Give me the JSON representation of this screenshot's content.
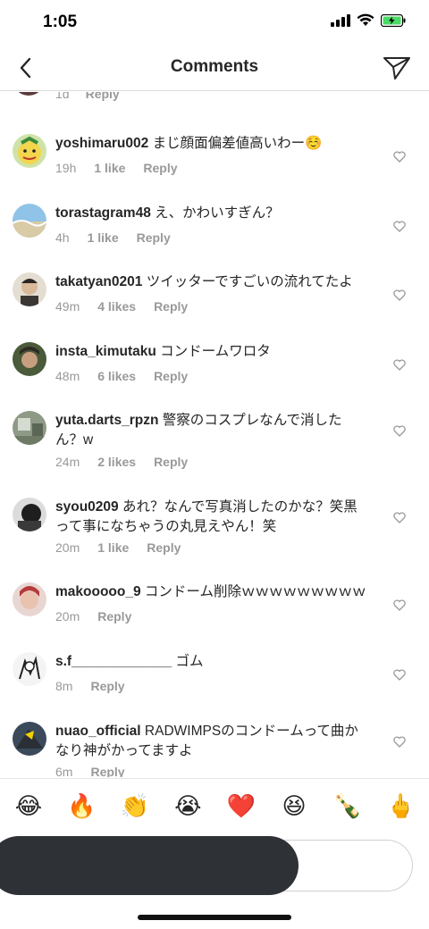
{
  "status": {
    "time": "1:05"
  },
  "nav": {
    "title": "Comments"
  },
  "partial": {
    "time": "1d",
    "reply": "Reply"
  },
  "comments": [
    {
      "user": "yoshimaru002",
      "text": "まじ顔面偏差値高いわー☺️",
      "time": "19h",
      "likes": "1 like",
      "reply": "Reply"
    },
    {
      "user": "torastagram48",
      "text": "え、かわいすぎん？",
      "time": "4h",
      "likes": "1 like",
      "reply": "Reply"
    },
    {
      "user": "takatyan0201",
      "text": "ツイッターですごいの流れてたよ",
      "time": "49m",
      "likes": "4 likes",
      "reply": "Reply"
    },
    {
      "user": "insta_kimutaku",
      "text": "コンドームワロタ",
      "time": "48m",
      "likes": "6 likes",
      "reply": "Reply"
    },
    {
      "user": "yuta.darts_rpzn",
      "text": "警察のコスプレなんで消したん？w",
      "time": "24m",
      "likes": "2 likes",
      "reply": "Reply"
    },
    {
      "user": "syou0209",
      "text": "あれ？なんで写真消したのかな？笑黒って事になちゃうの丸見えやん！笑",
      "time": "20m",
      "likes": "1 like",
      "reply": "Reply"
    },
    {
      "user": "makooooo_9",
      "text": "コンドーム削除ｗｗｗｗｗｗｗｗｗ",
      "time": "20m",
      "likes": "",
      "reply": "Reply"
    },
    {
      "user": "s.f_____________",
      "text": "ゴム",
      "time": "8m",
      "likes": "",
      "reply": "Reply"
    },
    {
      "user": "nuao_official",
      "text": "RADWIMPSのコンドームって曲かなり神がかってますよ",
      "time": "6m",
      "likes": "",
      "reply": "Reply"
    }
  ],
  "emojis": [
    "😂",
    "🔥",
    "👏",
    "😭",
    "❤️",
    "😆",
    "🍾",
    "🖕"
  ],
  "icons": {
    "back": "chevron-left-icon",
    "send": "paper-plane-icon",
    "heart": "heart-outline-icon"
  },
  "colors": {
    "input_dark": "#2e3135",
    "heart_red": "#ed1c24",
    "meta_gray": "#999999"
  }
}
